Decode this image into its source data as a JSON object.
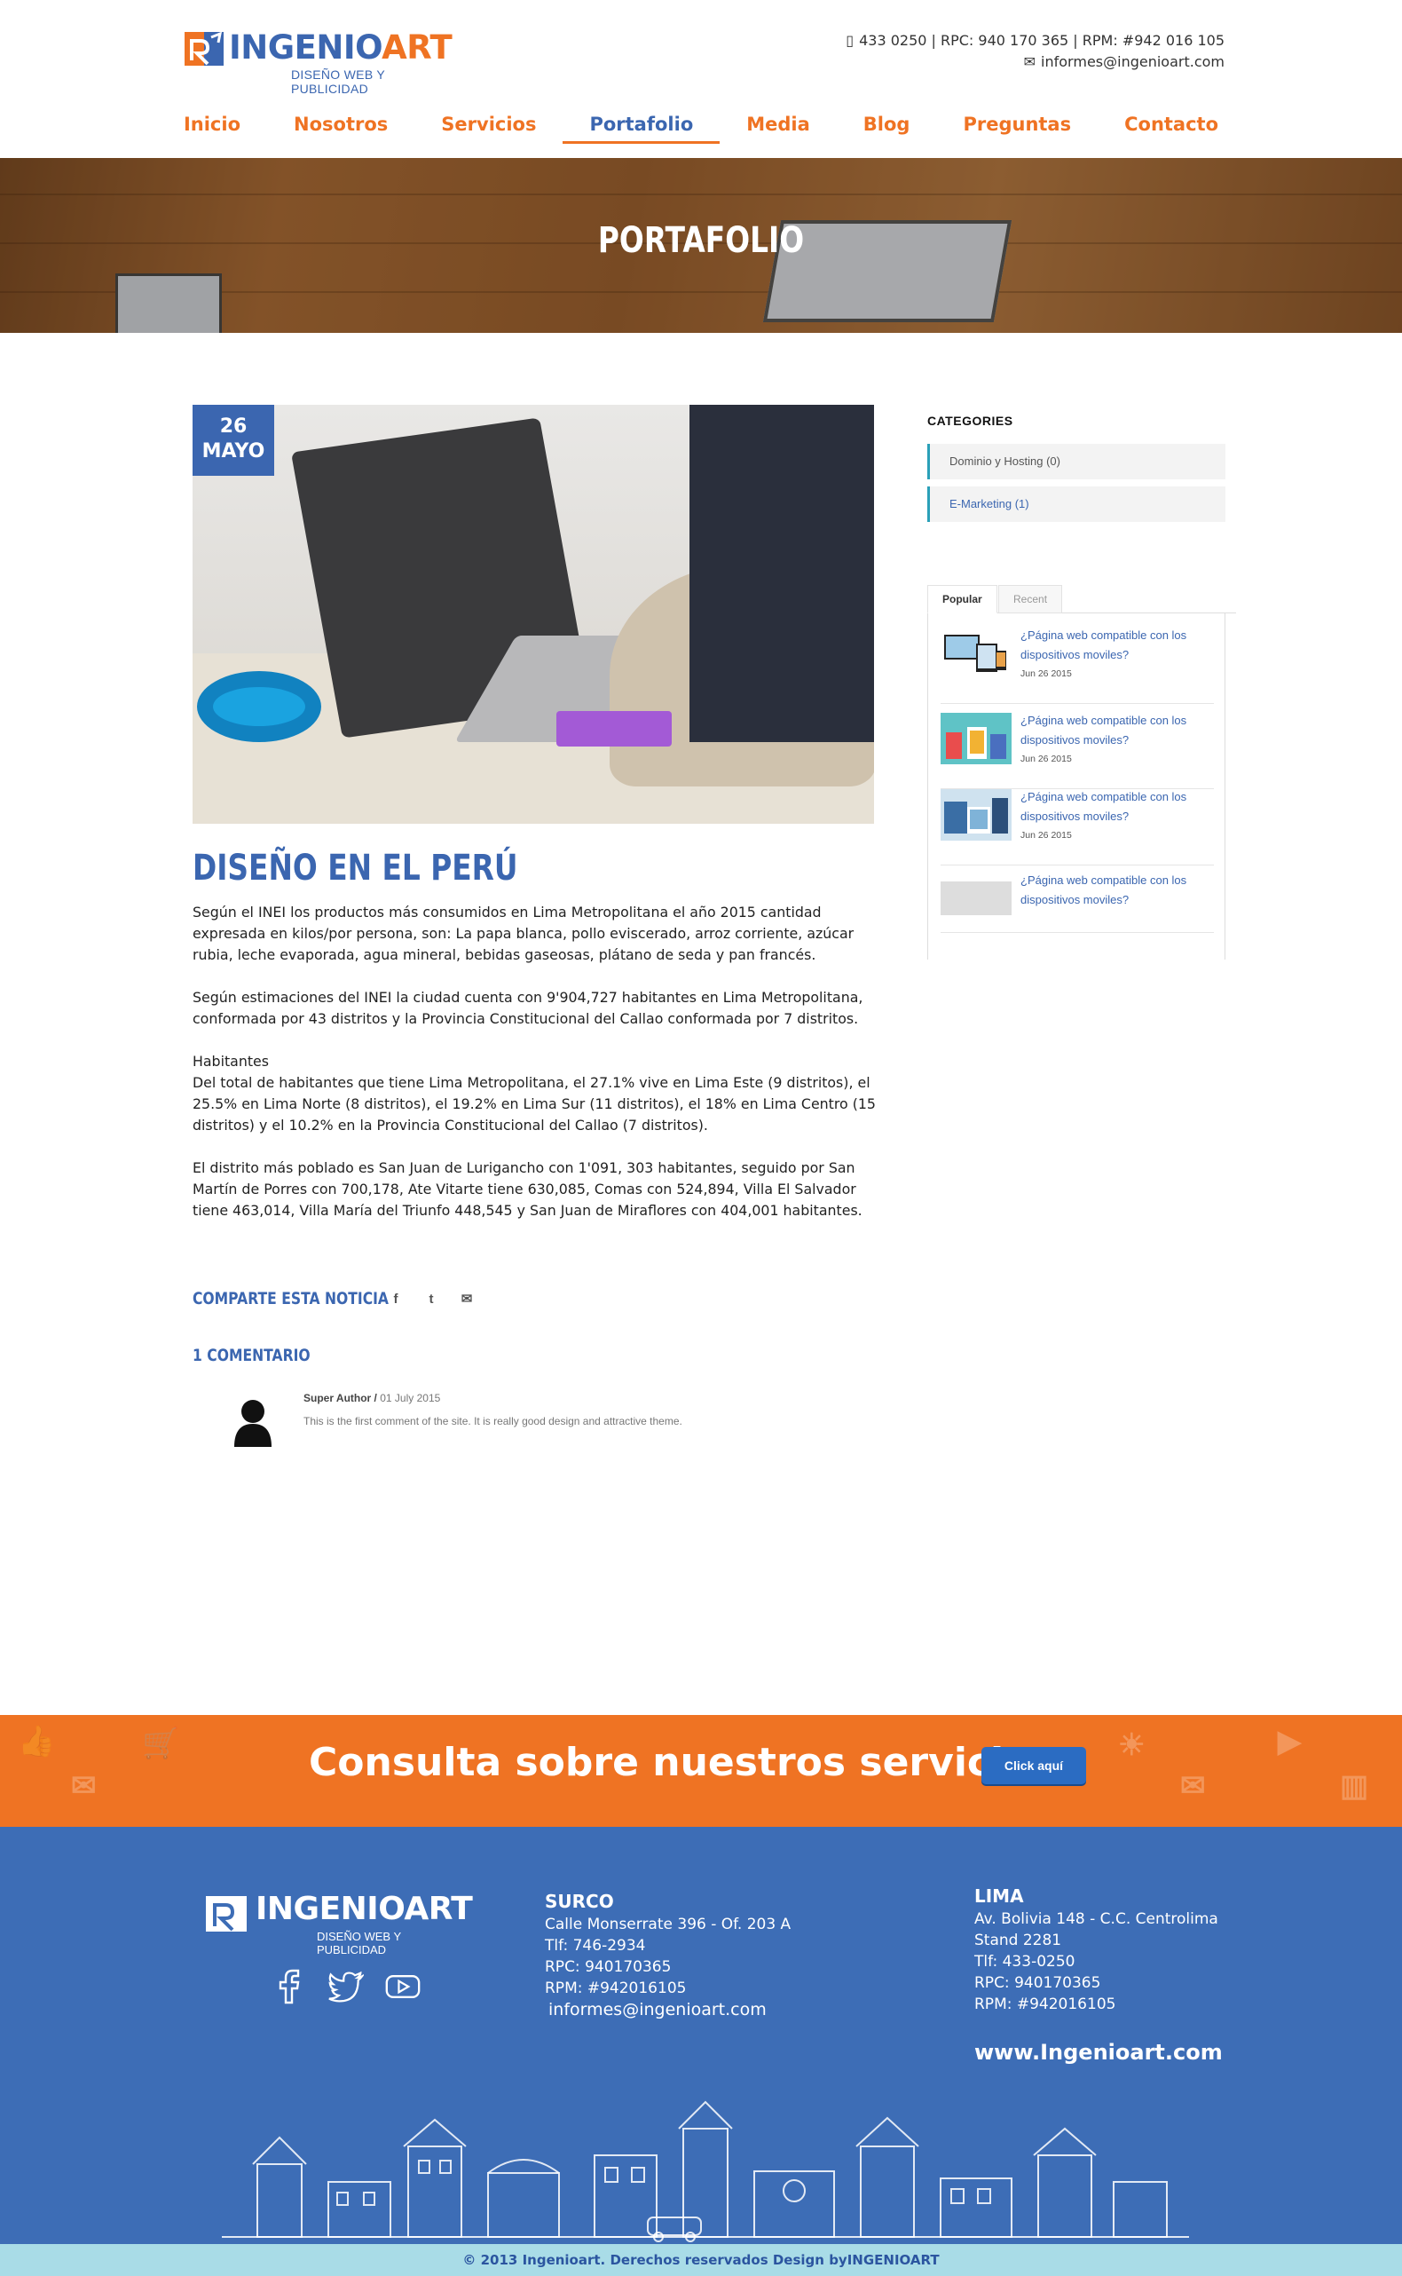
{
  "brand": {
    "name_part1": "INGENIO",
    "name_part2": "ART",
    "tagline": "DISEÑO WEB Y PUBLICIDAD",
    "color_blue": "#3b66b0",
    "color_orange": "#ef7323"
  },
  "top_contact": {
    "phones": "433 0250 | RPC: 940 170 365 | RPM: #942 016 105",
    "email": "informes@ingenioart.com",
    "phone_icon": "phone-icon",
    "mail_icon": "mail-icon"
  },
  "nav": {
    "items": [
      "Inicio",
      "Nosotros",
      "Servicios",
      "Portafolio",
      "Media",
      "Blog",
      "Preguntas",
      "Contacto"
    ],
    "active": "Portafolio"
  },
  "hero": {
    "title": "PORTAFOLIO"
  },
  "article": {
    "date_day": "26",
    "date_month": "MAYO",
    "title": "DISEÑO EN EL PERÚ",
    "paragraphs": [
      "Según el INEI los productos más consumidos en Lima Metropolitana el año 2015 cantidad expresada en kilos/por persona, son: La papa blanca, pollo eviscerado, arroz corriente, azúcar rubia, leche evaporada, agua mineral, bebidas gaseosas, plátano de seda y pan francés.",
      "Según estimaciones del INEI la ciudad cuenta con 9'904,727 habitantes en Lima Metropolitana, conformada por 43 distritos y la Provincia Constitucional del Callao conformada por 7 distritos.",
      "Habitantes",
      "Del total de habitantes que tiene Lima Metropolitana, el 27.1% vive en Lima Este (9 distritos), el 25.5% en Lima Norte (8 distritos), el 19.2% en Lima Sur (11 distritos), el 18% en Lima Centro (15 distritos) y el 10.2% en la Provincia Constitucional del Callao (7 distritos).",
      "El distrito más poblado es San Juan de Lurigancho con 1'091, 303 habitantes, seguido por San Martín de Porres con 700,178, Ate Vitarte tiene 630,085, Comas con 524,894, Villa El Salvador tiene 463,014, Villa María del Triunfo 448,545 y San Juan de Miraflores con 404,001 habitantes."
    ],
    "share_label": "COMPARTE ESTA NOTICIA",
    "share_icons": [
      "facebook-icon",
      "twitter-icon",
      "email-icon"
    ],
    "share_glyphs": {
      "facebook": "f",
      "twitter": "t",
      "email": "✉"
    }
  },
  "comments": {
    "title": "1 COMENTARIO",
    "items": [
      {
        "author": "Super Author /",
        "date": "01 July 2015",
        "text": "This is the first comment of the site. It is really good design and attractive theme."
      }
    ]
  },
  "sidebar": {
    "categories_title": "CATEGORIES",
    "categories": [
      "Dominio y Hosting (0)",
      "E-Marketing (1)"
    ],
    "tabs": [
      "Popular",
      "Recent"
    ],
    "active_tab": "Popular",
    "posts": [
      {
        "title": "¿Página web compatible con los dispositivos moviles?",
        "date": "Jun 26 2015"
      },
      {
        "title": "¿Página web compatible con los dispositivos moviles?",
        "date": "Jun 26 2015"
      },
      {
        "title": "¿Página web compatible con los dispositivos moviles?",
        "date": "Jun 26 2015"
      },
      {
        "title": "¿Página web compatible con los dispositivos moviles?",
        "date": ""
      }
    ]
  },
  "cta": {
    "text": "Consulta sobre nuestros servicios",
    "button": "Click aquí"
  },
  "footer": {
    "social_icons": [
      "facebook-icon",
      "twitter-icon",
      "youtube-icon"
    ],
    "surco": {
      "heading": "SURCO",
      "lines": [
        "Calle Monserrate 396 - Of. 203 A",
        "Tlf: 746-2934",
        "RPC: 940170365",
        "RPM: #942016105",
        "informes@ingenioart.com"
      ]
    },
    "lima": {
      "heading": "LIMA",
      "lines": [
        "Av. Bolivia 148 - C.C. Centrolima",
        "Stand 2281",
        "Tlf: 433-0250",
        "RPC: 940170365",
        "RPM: #942016105"
      ]
    },
    "website": "www.Ingenioart.com",
    "copyright": "© 2013 Ingenioart. Derechos reservados Design byINGENIOART"
  }
}
